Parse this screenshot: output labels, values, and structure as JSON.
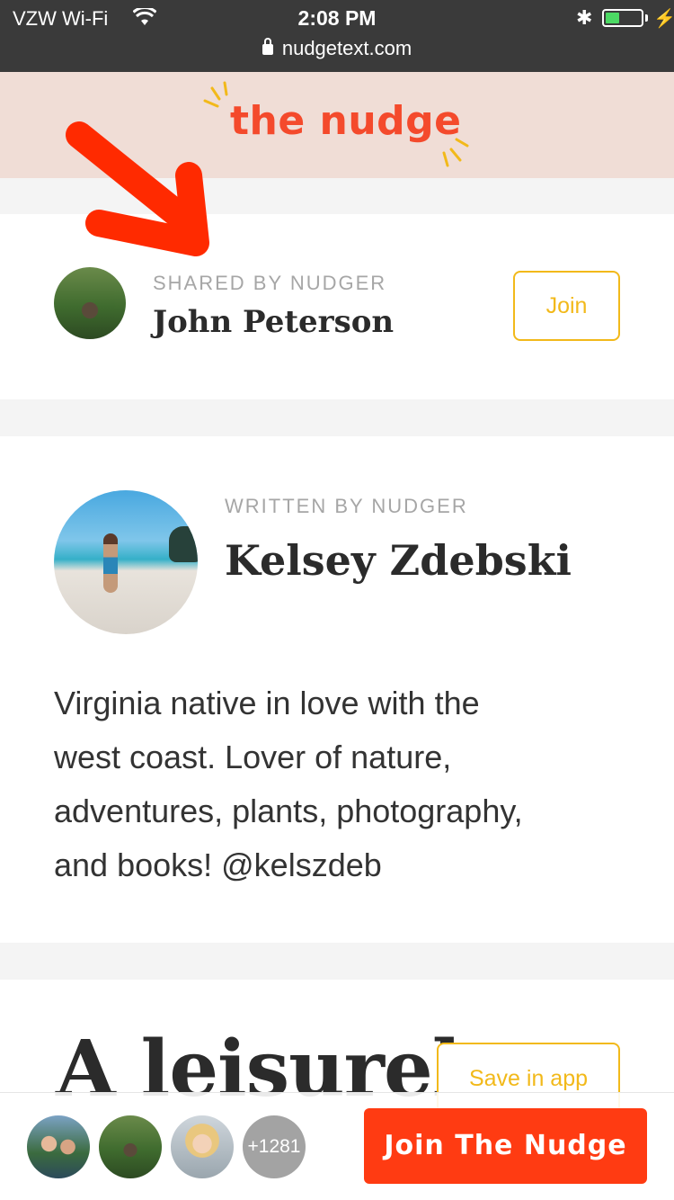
{
  "status_bar": {
    "carrier": "VZW Wi-Fi",
    "time": "2:08 PM",
    "url": "nudgetext.com",
    "battery_level": 0.4,
    "battery_color": "#4cd964"
  },
  "header": {
    "logo_text": "the nudge",
    "logo_color": "#f44a2c",
    "background": "#f0ddd6"
  },
  "shared_card": {
    "label": "SHARED BY NUDGER",
    "name": "John Peterson",
    "join_label": "Join"
  },
  "writer_card": {
    "label": "WRITTEN BY NUDGER",
    "name": "Kelsey Zdebski",
    "bio_lines": [
      "Virginia native in love with the",
      "west coast. Lover of nature,",
      "adventures, plants, photography,",
      "and books! @kelszdeb"
    ]
  },
  "article": {
    "headline": "A leisurely",
    "save_label": "Save in app"
  },
  "bottom_bar": {
    "member_count": "+1281",
    "cta_label": "Join The Nudge",
    "cta_color": "#ff3b12"
  },
  "accent_color": "#f2b91a",
  "icons": [
    "wifi-icon",
    "lock-icon",
    "bluetooth-icon",
    "battery-icon",
    "charging-icon",
    "annotation-arrow-icon"
  ]
}
